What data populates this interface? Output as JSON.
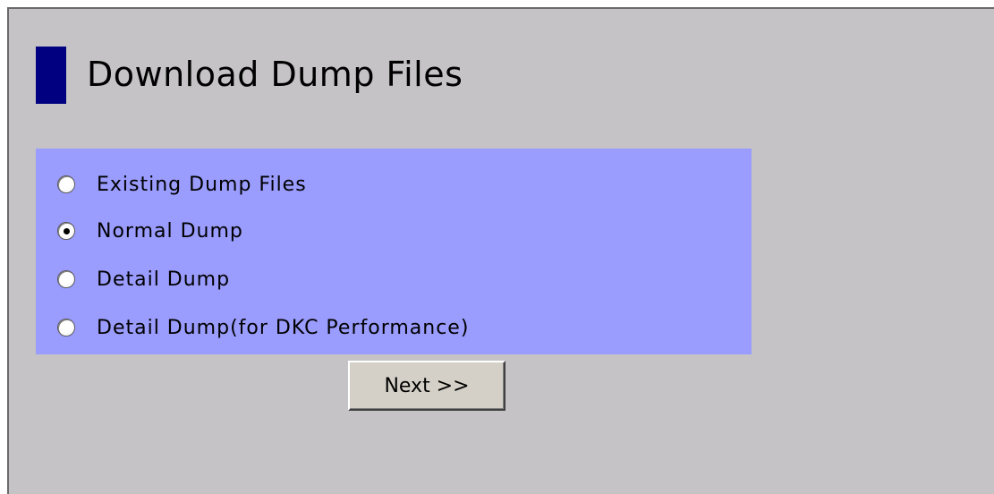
{
  "page": {
    "title": "Download Dump Files"
  },
  "options": [
    {
      "label": "Existing Dump Files",
      "checked": false
    },
    {
      "label": "Normal Dump",
      "checked": true
    },
    {
      "label": "Detail Dump",
      "checked": false
    },
    {
      "label": "Detail Dump(for DKC Performance)",
      "checked": false
    }
  ],
  "buttons": {
    "next_label": "Next >>"
  },
  "colors": {
    "panel_background": "#c5c3c5",
    "title_bar": "#000080",
    "options_background": "#9a9cfe"
  }
}
